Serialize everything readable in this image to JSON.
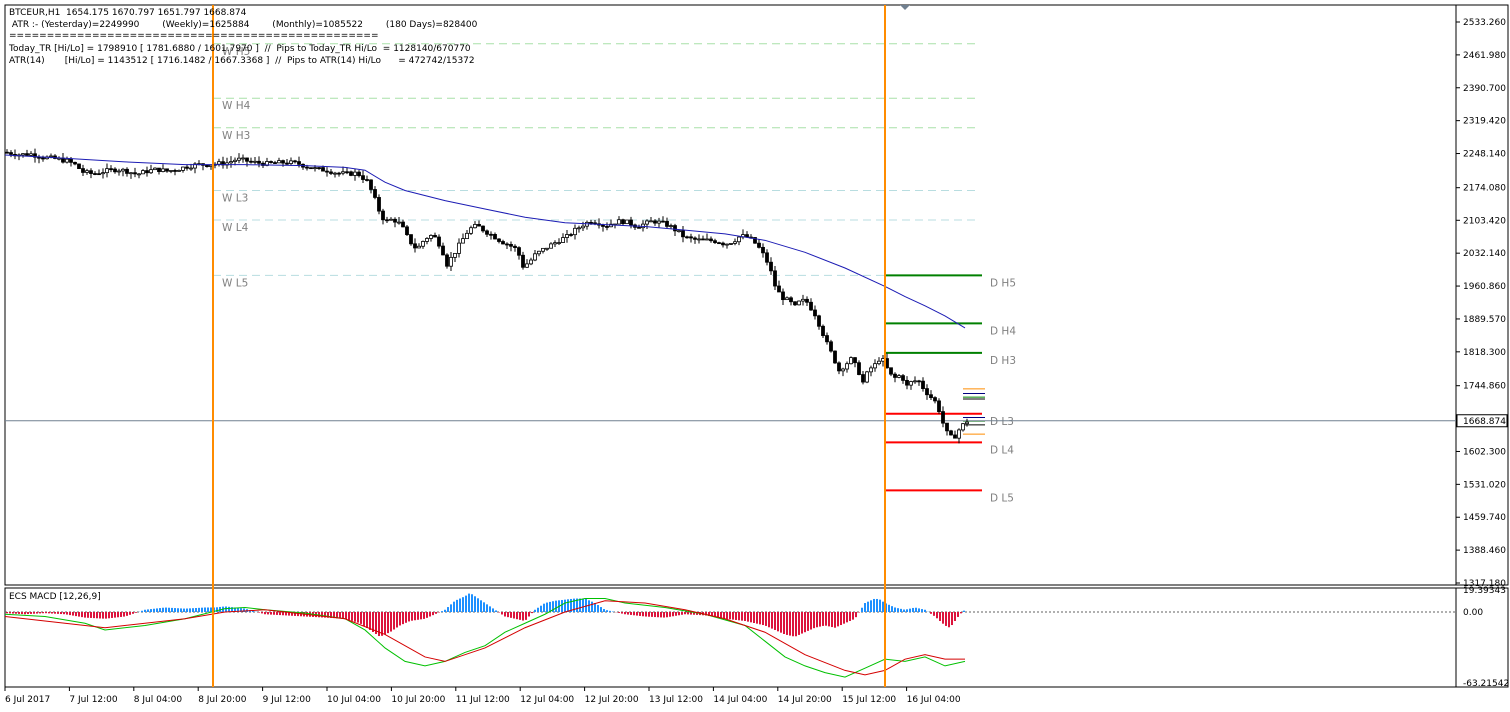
{
  "header": {
    "line1": "BTCEUR,H1  1654.175 1670.797 1651.797 1668.874",
    "line2": " ATR :- (Yesterday)=2249990        (Weekly)=1625884        (Monthly)=1085522        (180 Days)=828400",
    "line3": "=================================================",
    "line4": "Today_TR [Hi/Lo] = 1798910 [ 1781.6880 / 1601.7970 ]  //  Pips to Today_TR Hi/Lo  = 1128140/670770",
    "line5": "ATR(14)       [Hi/Lo] = 1143512 [ 1716.1482 / 1667.3368 ]  //  Pips to ATR(14) Hi/Lo      = 472742/15372"
  },
  "macd": {
    "label": "ECS MACD [12,26,9]",
    "ticks": [
      "19.39343",
      "0.00",
      "-63.21542"
    ]
  },
  "current_price": "1668.874",
  "colors": {
    "candle": "#000000",
    "ma": "#1c1cb4",
    "session": "#ff8c00",
    "d_high": "#008000",
    "d_low": "#ff0000",
    "w_level": "#a8e0a8",
    "w_level_low": "#b8dde0",
    "hist_pos": "#1e90ff",
    "hist_neg": "#dc143c",
    "macd_line": "#00c000",
    "signal_line": "#d40000",
    "price_line": "#708090"
  },
  "chart_data": {
    "type": "candlestick",
    "symbol": "BTCEUR",
    "timeframe": "H1",
    "price_axis_ticks": [
      "2533.260",
      "2461.980",
      "2390.700",
      "2319.420",
      "2248.140",
      "2174.080",
      "2103.420",
      "2032.140",
      "1960.860",
      "1889.570",
      "1818.300",
      "1744.860",
      "1673.580",
      "1602.300",
      "1531.020",
      "1459.740",
      "1388.460",
      "1317.180"
    ],
    "ylim": [
      1317.18,
      2533.26
    ],
    "time_axis_labels": [
      "6 Jul 2017",
      "7 Jul 12:00",
      "8 Jul 04:00",
      "8 Jul 20:00",
      "9 Jul 12:00",
      "10 Jul 04:00",
      "10 Jul 20:00",
      "11 Jul 12:00",
      "12 Jul 04:00",
      "12 Jul 20:00",
      "13 Jul 12:00",
      "14 Jul 04:00",
      "14 Jul 20:00",
      "15 Jul 12:00",
      "16 Jul 04:00"
    ],
    "close_path": [
      [
        0,
        2251
      ],
      [
        14,
        2246
      ],
      [
        26,
        2247
      ],
      [
        38,
        2240
      ],
      [
        50,
        2237
      ],
      [
        62,
        2232
      ],
      [
        70,
        2224
      ],
      [
        78,
        2208
      ],
      [
        88,
        2204
      ],
      [
        100,
        2210
      ],
      [
        112,
        2214
      ],
      [
        122,
        2210
      ],
      [
        132,
        2203
      ],
      [
        142,
        2210
      ],
      [
        152,
        2214
      ],
      [
        162,
        2210
      ],
      [
        172,
        2214
      ],
      [
        182,
        2220
      ],
      [
        192,
        2224
      ],
      [
        202,
        2224
      ],
      [
        212,
        2226
      ],
      [
        222,
        2228
      ],
      [
        232,
        2236
      ],
      [
        242,
        2232
      ],
      [
        252,
        2228
      ],
      [
        262,
        2226
      ],
      [
        272,
        2228
      ],
      [
        282,
        2229
      ],
      [
        292,
        2227
      ],
      [
        302,
        2220
      ],
      [
        312,
        2214
      ],
      [
        322,
        2212
      ],
      [
        332,
        2206
      ],
      [
        342,
        2204
      ],
      [
        352,
        2206
      ],
      [
        362,
        2188
      ],
      [
        368,
        2160
      ],
      [
        374,
        2125
      ],
      [
        380,
        2100
      ],
      [
        388,
        2106
      ],
      [
        396,
        2094
      ],
      [
        404,
        2060
      ],
      [
        412,
        2040
      ],
      [
        420,
        2064
      ],
      [
        428,
        2072
      ],
      [
        436,
        2046
      ],
      [
        442,
        2008
      ],
      [
        448,
        2028
      ],
      [
        456,
        2056
      ],
      [
        464,
        2084
      ],
      [
        472,
        2092
      ],
      [
        480,
        2080
      ],
      [
        488,
        2070
      ],
      [
        496,
        2058
      ],
      [
        504,
        2050
      ],
      [
        512,
        2040
      ],
      [
        518,
        2004
      ],
      [
        524,
        2012
      ],
      [
        530,
        2028
      ],
      [
        538,
        2040
      ],
      [
        546,
        2050
      ],
      [
        554,
        2060
      ],
      [
        562,
        2068
      ],
      [
        570,
        2082
      ],
      [
        578,
        2094
      ],
      [
        586,
        2102
      ],
      [
        594,
        2098
      ],
      [
        600,
        2090
      ],
      [
        608,
        2098
      ],
      [
        616,
        2102
      ],
      [
        624,
        2098
      ],
      [
        632,
        2090
      ],
      [
        640,
        2096
      ],
      [
        648,
        2102
      ],
      [
        656,
        2098
      ],
      [
        664,
        2092
      ],
      [
        672,
        2080
      ],
      [
        680,
        2066
      ],
      [
        688,
        2062
      ],
      [
        696,
        2060
      ],
      [
        704,
        2060
      ],
      [
        712,
        2058
      ],
      [
        720,
        2052
      ],
      [
        728,
        2058
      ],
      [
        736,
        2070
      ],
      [
        744,
        2066
      ],
      [
        752,
        2050
      ],
      [
        758,
        2030
      ],
      [
        764,
        2006
      ],
      [
        770,
        1962
      ],
      [
        776,
        1938
      ],
      [
        784,
        1928
      ],
      [
        790,
        1916
      ],
      [
        796,
        1930
      ],
      [
        802,
        1926
      ],
      [
        810,
        1900
      ],
      [
        816,
        1868
      ],
      [
        822,
        1836
      ],
      [
        828,
        1808
      ],
      [
        834,
        1778
      ],
      [
        840,
        1790
      ],
      [
        846,
        1802
      ],
      [
        852,
        1784
      ],
      [
        858,
        1752
      ],
      [
        864,
        1780
      ],
      [
        870,
        1790
      ],
      [
        876,
        1808
      ],
      [
        882,
        1782
      ],
      [
        888,
        1760
      ],
      [
        896,
        1768
      ],
      [
        902,
        1744
      ],
      [
        908,
        1756
      ],
      [
        914,
        1754
      ],
      [
        920,
        1734
      ],
      [
        926,
        1720
      ],
      [
        932,
        1706
      ],
      [
        938,
        1664
      ],
      [
        944,
        1632
      ],
      [
        950,
        1636
      ],
      [
        956,
        1656
      ],
      [
        962,
        1668
      ]
    ],
    "moving_average": [
      [
        0,
        2245
      ],
      [
        60,
        2238
      ],
      [
        120,
        2230
      ],
      [
        180,
        2224
      ],
      [
        240,
        2224
      ],
      [
        300,
        2222
      ],
      [
        340,
        2218
      ],
      [
        360,
        2212
      ],
      [
        380,
        2186
      ],
      [
        400,
        2168
      ],
      [
        440,
        2146
      ],
      [
        480,
        2128
      ],
      [
        520,
        2110
      ],
      [
        560,
        2098
      ],
      [
        600,
        2094
      ],
      [
        640,
        2090
      ],
      [
        680,
        2082
      ],
      [
        720,
        2074
      ],
      [
        760,
        2060
      ],
      [
        800,
        2034
      ],
      [
        840,
        2000
      ],
      [
        880,
        1960
      ],
      [
        900,
        1938
      ],
      [
        920,
        1918
      ],
      [
        940,
        1896
      ],
      [
        960,
        1870
      ]
    ],
    "session_separators": [
      "8 Jul 20:00",
      "15 Jul 12:00"
    ],
    "weekly_levels": [
      {
        "label": "W H5",
        "price": 2486
      },
      {
        "label": "W H4",
        "price": 2368
      },
      {
        "label": "W H3",
        "price": 2304
      },
      {
        "label": "W L3",
        "price": 2168
      },
      {
        "label": "W L4",
        "price": 2104
      },
      {
        "label": "W L5",
        "price": 1984
      }
    ],
    "daily_levels": [
      {
        "label": "D H5",
        "price": 1984,
        "kind": "high"
      },
      {
        "label": "D H4",
        "price": 1880,
        "kind": "high"
      },
      {
        "label": "D H3",
        "price": 1816,
        "kind": "high"
      },
      {
        "label": "D L3",
        "price": 1684,
        "kind": "low"
      },
      {
        "label": "D L4",
        "price": 1622,
        "kind": "low"
      },
      {
        "label": "D L5",
        "price": 1518,
        "kind": "low"
      }
    ],
    "macd": {
      "ylim": [
        -63.21542,
        19.39343
      ],
      "histogram": [
        [
          0,
          -1
        ],
        [
          20,
          -2
        ],
        [
          40,
          -1
        ],
        [
          60,
          -2
        ],
        [
          80,
          -5
        ],
        [
          100,
          -6
        ],
        [
          120,
          -4
        ],
        [
          140,
          2
        ],
        [
          160,
          4
        ],
        [
          180,
          3
        ],
        [
          200,
          4
        ],
        [
          210,
          4
        ],
        [
          220,
          5
        ],
        [
          240,
          3
        ],
        [
          260,
          -2
        ],
        [
          280,
          -3
        ],
        [
          300,
          -4
        ],
        [
          320,
          -5
        ],
        [
          340,
          -6
        ],
        [
          355,
          -10
        ],
        [
          365,
          -16
        ],
        [
          375,
          -22
        ],
        [
          385,
          -18
        ],
        [
          395,
          -12
        ],
        [
          405,
          -8
        ],
        [
          420,
          -6
        ],
        [
          440,
          2
        ],
        [
          450,
          10
        ],
        [
          460,
          14
        ],
        [
          465,
          17
        ],
        [
          470,
          14
        ],
        [
          480,
          8
        ],
        [
          490,
          2
        ],
        [
          500,
          -4
        ],
        [
          510,
          -6
        ],
        [
          520,
          -8
        ],
        [
          530,
          2
        ],
        [
          540,
          8
        ],
        [
          550,
          10
        ],
        [
          560,
          11
        ],
        [
          570,
          12
        ],
        [
          580,
          12
        ],
        [
          590,
          8
        ],
        [
          600,
          2
        ],
        [
          620,
          -2
        ],
        [
          640,
          -4
        ],
        [
          660,
          -5
        ],
        [
          680,
          -2
        ],
        [
          700,
          -3
        ],
        [
          720,
          -6
        ],
        [
          740,
          -8
        ],
        [
          760,
          -12
        ],
        [
          770,
          -16
        ],
        [
          780,
          -20
        ],
        [
          790,
          -22
        ],
        [
          800,
          -18
        ],
        [
          810,
          -14
        ],
        [
          820,
          -12
        ],
        [
          830,
          -14
        ],
        [
          840,
          -10
        ],
        [
          850,
          -6
        ],
        [
          860,
          8
        ],
        [
          870,
          12
        ],
        [
          875,
          11
        ],
        [
          880,
          8
        ],
        [
          890,
          4
        ],
        [
          900,
          2
        ],
        [
          910,
          4
        ],
        [
          920,
          2
        ],
        [
          930,
          -4
        ],
        [
          940,
          -12
        ],
        [
          945,
          -14
        ],
        [
          950,
          -8
        ],
        [
          955,
          -2
        ],
        [
          960,
          2
        ]
      ],
      "macd_line": [
        [
          0,
          -2
        ],
        [
          40,
          -4
        ],
        [
          80,
          -10
        ],
        [
          100,
          -16
        ],
        [
          140,
          -12
        ],
        [
          180,
          -6
        ],
        [
          220,
          3
        ],
        [
          240,
          4
        ],
        [
          260,
          2
        ],
        [
          300,
          -1
        ],
        [
          340,
          -6
        ],
        [
          360,
          -16
        ],
        [
          380,
          -32
        ],
        [
          400,
          -44
        ],
        [
          420,
          -48
        ],
        [
          440,
          -44
        ],
        [
          460,
          -36
        ],
        [
          480,
          -30
        ],
        [
          500,
          -18
        ],
        [
          520,
          -10
        ],
        [
          540,
          -2
        ],
        [
          560,
          8
        ],
        [
          580,
          12
        ],
        [
          600,
          12
        ],
        [
          620,
          8
        ],
        [
          660,
          4
        ],
        [
          700,
          -2
        ],
        [
          740,
          -12
        ],
        [
          760,
          -26
        ],
        [
          780,
          -40
        ],
        [
          800,
          -48
        ],
        [
          820,
          -54
        ],
        [
          840,
          -58
        ],
        [
          860,
          -50
        ],
        [
          880,
          -42
        ],
        [
          900,
          -44
        ],
        [
          920,
          -40
        ],
        [
          940,
          -48
        ],
        [
          960,
          -44
        ]
      ],
      "signal_line": [
        [
          0,
          -4
        ],
        [
          60,
          -10
        ],
        [
          100,
          -14
        ],
        [
          140,
          -10
        ],
        [
          180,
          -6
        ],
        [
          220,
          0
        ],
        [
          260,
          2
        ],
        [
          300,
          -2
        ],
        [
          340,
          -6
        ],
        [
          380,
          -20
        ],
        [
          420,
          -40
        ],
        [
          440,
          -44
        ],
        [
          480,
          -32
        ],
        [
          520,
          -14
        ],
        [
          560,
          0
        ],
        [
          600,
          10
        ],
        [
          640,
          8
        ],
        [
          680,
          2
        ],
        [
          720,
          -6
        ],
        [
          760,
          -18
        ],
        [
          800,
          -38
        ],
        [
          840,
          -52
        ],
        [
          860,
          -56
        ],
        [
          880,
          -52
        ],
        [
          900,
          -42
        ],
        [
          920,
          -38
        ],
        [
          940,
          -42
        ],
        [
          960,
          -42
        ]
      ]
    }
  }
}
